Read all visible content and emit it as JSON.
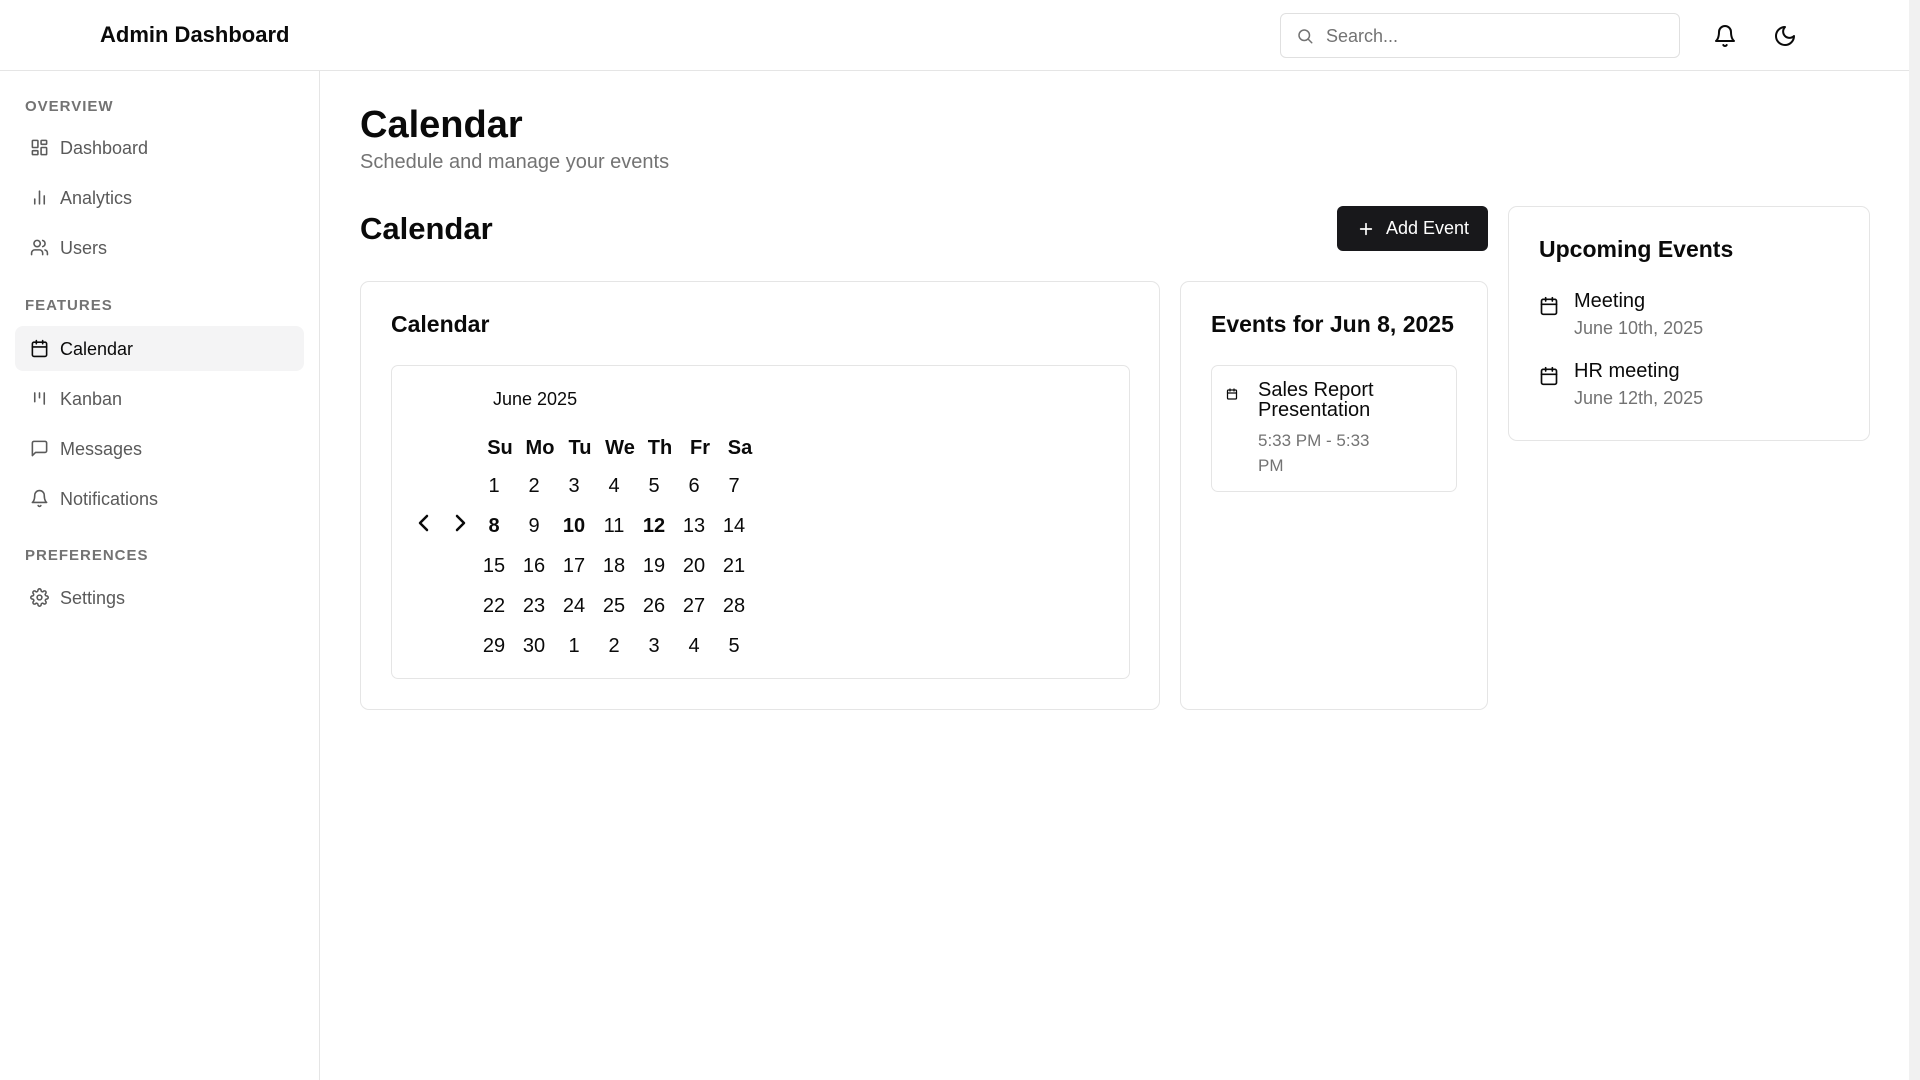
{
  "header": {
    "title": "Admin Dashboard",
    "search_placeholder": "Search..."
  },
  "sidebar": {
    "sections": [
      {
        "label": "OVERVIEW",
        "items": [
          {
            "label": "Dashboard",
            "icon": "layout-grid-icon"
          },
          {
            "label": "Analytics",
            "icon": "bar-chart-icon"
          },
          {
            "label": "Users",
            "icon": "users-icon"
          }
        ]
      },
      {
        "label": "FEATURES",
        "items": [
          {
            "label": "Calendar",
            "icon": "calendar-icon",
            "active": true
          },
          {
            "label": "Kanban",
            "icon": "kanban-icon"
          },
          {
            "label": "Messages",
            "icon": "message-square-icon"
          },
          {
            "label": "Notifications",
            "icon": "bell-icon"
          }
        ]
      },
      {
        "label": "PREFERENCES",
        "items": [
          {
            "label": "Settings",
            "icon": "gear-icon"
          }
        ]
      }
    ]
  },
  "page": {
    "title": "Calendar",
    "subtitle": "Schedule and manage your events",
    "section_title": "Calendar",
    "add_event_label": "Add Event"
  },
  "calendar_card": {
    "title": "Calendar",
    "month_caption": "June 2025",
    "weekdays": [
      "Su",
      "Mo",
      "Tu",
      "We",
      "Th",
      "Fr",
      "Sa"
    ],
    "weeks": [
      [
        "1",
        "2",
        "3",
        "4",
        "5",
        "6",
        "7"
      ],
      [
        "8",
        "9",
        "10",
        "11",
        "12",
        "13",
        "14"
      ],
      [
        "15",
        "16",
        "17",
        "18",
        "19",
        "20",
        "21"
      ],
      [
        "22",
        "23",
        "24",
        "25",
        "26",
        "27",
        "28"
      ],
      [
        "29",
        "30",
        "1",
        "2",
        "3",
        "4",
        "5"
      ]
    ],
    "selected_day": "8",
    "days_with_events": [
      "10",
      "12"
    ]
  },
  "events_card": {
    "title": "Events for Jun 8, 2025",
    "events": [
      {
        "name": "Sales Report Presentation",
        "time": "5:33 PM - 5:33 PM"
      }
    ]
  },
  "upcoming": {
    "title": "Upcoming Events",
    "items": [
      {
        "name": "Meeting",
        "date": "June 10th, 2025"
      },
      {
        "name": "HR meeting",
        "date": "June 12th, 2025"
      }
    ]
  },
  "colors": {
    "accent": "#18181b",
    "muted_text": "#737373",
    "border": "#e5e5e5",
    "active_nav_bg": "#f4f4f5"
  }
}
